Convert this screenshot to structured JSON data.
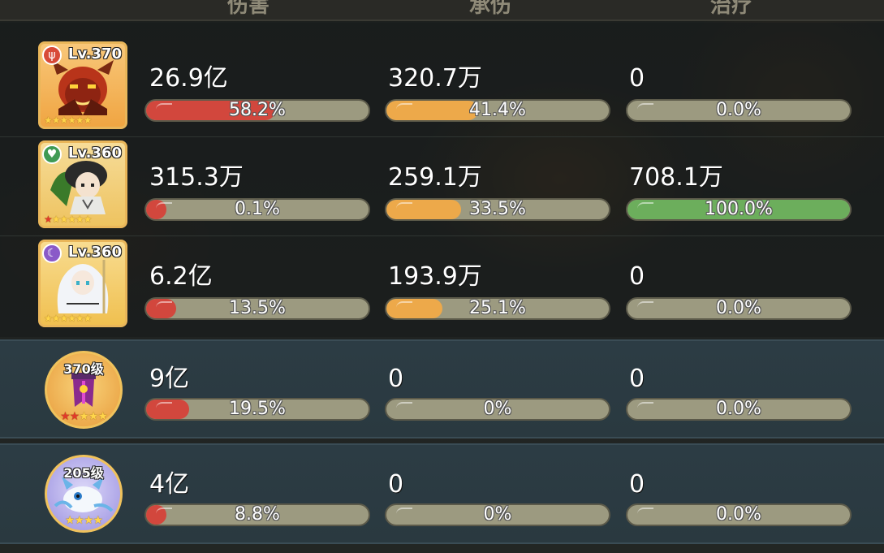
{
  "header": {
    "col1_label": "伤害",
    "col2_label": "承伤",
    "col3_label": "治疗"
  },
  "colors": {
    "damage_bar": "#d2473d",
    "taken_bar": "#eda94a",
    "heal_bar": "#6cae5c",
    "track": "#9c9a80"
  },
  "rows": [
    {
      "level": "Lv.370",
      "faction": "fire-faction-icon",
      "stars": 6,
      "red_stars": 0,
      "damage": {
        "value": "26.9亿",
        "pct_label": "58.2%",
        "fraction": 0.582
      },
      "taken": {
        "value": "320.7万",
        "pct_label": "41.4%",
        "fraction": 0.414
      },
      "heal": {
        "value": "0",
        "pct_label": "0.0%",
        "fraction": 0.0
      }
    },
    {
      "level": "Lv.360",
      "faction": "nature-faction-icon",
      "stars": 6,
      "red_stars": 1,
      "damage": {
        "value": "315.3万",
        "pct_label": "0.1%",
        "fraction": 0.001
      },
      "taken": {
        "value": "259.1万",
        "pct_label": "33.5%",
        "fraction": 0.335
      },
      "heal": {
        "value": "708.1万",
        "pct_label": "100.0%",
        "fraction": 1.0
      }
    },
    {
      "level": "Lv.360",
      "faction": "spirit-faction-icon",
      "stars": 6,
      "red_stars": 0,
      "damage": {
        "value": "6.2亿",
        "pct_label": "13.5%",
        "fraction": 0.135
      },
      "taken": {
        "value": "193.9万",
        "pct_label": "25.1%",
        "fraction": 0.251
      },
      "heal": {
        "value": "0",
        "pct_label": "0.0%",
        "fraction": 0.0
      }
    },
    {
      "level": "370级",
      "stars": 5,
      "red_stars": 2,
      "damage": {
        "value": "9亿",
        "pct_label": "19.5%",
        "fraction": 0.195
      },
      "taken": {
        "value": "0",
        "pct_label": "0%",
        "fraction": 0.0
      },
      "heal": {
        "value": "0",
        "pct_label": "0.0%",
        "fraction": 0.0
      }
    },
    {
      "level": "205级",
      "stars": 4,
      "red_stars": 0,
      "damage": {
        "value": "4亿",
        "pct_label": "8.8%",
        "fraction": 0.088
      },
      "taken": {
        "value": "0",
        "pct_label": "0%",
        "fraction": 0.0
      },
      "heal": {
        "value": "0",
        "pct_label": "0.0%",
        "fraction": 0.0
      }
    }
  ]
}
